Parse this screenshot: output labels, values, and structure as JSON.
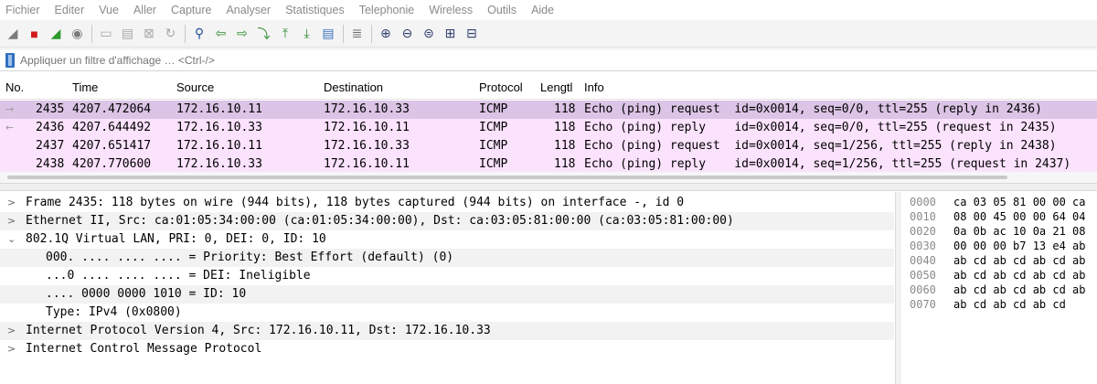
{
  "menu": [
    "Fichier",
    "Editer",
    "Vue",
    "Aller",
    "Capture",
    "Analyser",
    "Statistiques",
    "Telephonie",
    "Wireless",
    "Outils",
    "Aide"
  ],
  "toolbar": {
    "buttons": [
      {
        "name": "shark-fin-start-icon",
        "glyph": "◢",
        "color": "#7a7a7a"
      },
      {
        "name": "stop-capture-icon",
        "glyph": "■",
        "color": "#d11b1b"
      },
      {
        "name": "restart-capture-icon",
        "glyph": "◢",
        "color": "#2c9a2c"
      },
      {
        "name": "capture-options-icon",
        "glyph": "◉",
        "color": "#7a7a7a"
      },
      {
        "sep": true
      },
      {
        "name": "open-file-icon",
        "glyph": "▭",
        "color": "#a8a8a8"
      },
      {
        "name": "save-file-icon",
        "glyph": "▤",
        "color": "#a8a8a8"
      },
      {
        "name": "close-file-icon",
        "glyph": "⊠",
        "color": "#a8a8a8"
      },
      {
        "name": "reload-file-icon",
        "glyph": "↻",
        "color": "#a8a8a8"
      },
      {
        "sep": true
      },
      {
        "name": "find-packet-icon",
        "glyph": "⚲",
        "color": "#1f4f9a"
      },
      {
        "name": "go-back-icon",
        "glyph": "⇦",
        "color": "#2f8c2f"
      },
      {
        "name": "go-forward-icon",
        "glyph": "⇨",
        "color": "#2f8c2f"
      },
      {
        "name": "go-to-packet-icon",
        "glyph": "⤵",
        "color": "#2f8c2f"
      },
      {
        "name": "first-packet-icon",
        "glyph": "⤒",
        "color": "#2f8c2f"
      },
      {
        "name": "last-packet-icon",
        "glyph": "⤓",
        "color": "#2f8c2f"
      },
      {
        "name": "autoscroll-icon",
        "glyph": "▤",
        "color": "#3a6fc0"
      },
      {
        "sep": true
      },
      {
        "name": "colorize-icon",
        "glyph": "≣",
        "color": "#6b6b6b"
      },
      {
        "sep": true
      },
      {
        "name": "zoom-in-icon",
        "glyph": "⊕",
        "color": "#2f3f6f"
      },
      {
        "name": "zoom-out-icon",
        "glyph": "⊖",
        "color": "#2f3f6f"
      },
      {
        "name": "zoom-reset-icon",
        "glyph": "⊜",
        "color": "#2f3f6f"
      },
      {
        "name": "resize-columns-icon",
        "glyph": "⊞",
        "color": "#2f3f6f"
      },
      {
        "name": "expand-all-icon",
        "glyph": "⊟",
        "color": "#2f3f6f"
      }
    ]
  },
  "filter": {
    "placeholder": "Appliquer un filtre d'affichage … <Ctrl-/>"
  },
  "packet_list": {
    "columns": [
      "No.",
      "Time",
      "Source",
      "Destination",
      "Protocol",
      "Lengtl",
      "Info"
    ],
    "rows": [
      {
        "dir": "→",
        "no": "2435",
        "time": "4207.472064",
        "src": "172.16.10.11",
        "dst": "172.16.10.33",
        "proto": "ICMP",
        "len": "118",
        "info": "Echo (ping) request  id=0x0014, seq=0/0, ttl=255 (reply in 2436)",
        "bg": "#dcc4e6"
      },
      {
        "dir": "←",
        "no": "2436",
        "time": "4207.644492",
        "src": "172.16.10.33",
        "dst": "172.16.10.11",
        "proto": "ICMP",
        "len": "118",
        "info": "Echo (ping) reply    id=0x0014, seq=0/0, ttl=255 (request in 2435)",
        "bg": "#fbe2fd"
      },
      {
        "dir": "",
        "no": "2437",
        "time": "4207.651417",
        "src": "172.16.10.11",
        "dst": "172.16.10.33",
        "proto": "ICMP",
        "len": "118",
        "info": "Echo (ping) request  id=0x0014, seq=1/256, ttl=255 (reply in 2438)",
        "bg": "#fbe2fd"
      },
      {
        "dir": "",
        "no": "2438",
        "time": "4207.770600",
        "src": "172.16.10.33",
        "dst": "172.16.10.11",
        "proto": "ICMP",
        "len": "118",
        "info": "Echo (ping) reply    id=0x0014, seq=1/256, ttl=255 (request in 2437)",
        "bg": "#fbe2fd"
      }
    ]
  },
  "details": [
    {
      "chev": ">",
      "indent": 0,
      "text": "Frame 2435: 118 bytes on wire (944 bits), 118 bytes captured (944 bits) on interface -, id 0",
      "alt": false
    },
    {
      "chev": ">",
      "indent": 0,
      "text": "Ethernet II, Src: ca:01:05:34:00:00 (ca:01:05:34:00:00), Dst: ca:03:05:81:00:00 (ca:03:05:81:00:00)",
      "alt": true
    },
    {
      "chev": "⌄",
      "indent": 0,
      "text": "802.1Q Virtual LAN, PRI: 0, DEI: 0, ID: 10",
      "alt": false
    },
    {
      "chev": "",
      "indent": 1,
      "text": "000. .... .... .... = Priority: Best Effort (default) (0)",
      "alt": true
    },
    {
      "chev": "",
      "indent": 1,
      "text": "...0 .... .... .... = DEI: Ineligible",
      "alt": false
    },
    {
      "chev": "",
      "indent": 1,
      "text": ".... 0000 0000 1010 = ID: 10",
      "alt": true
    },
    {
      "chev": "",
      "indent": 1,
      "text": "Type: IPv4 (0x0800)",
      "alt": false
    },
    {
      "chev": ">",
      "indent": 0,
      "text": "Internet Protocol Version 4, Src: 172.16.10.11, Dst: 172.16.10.33",
      "alt": true
    },
    {
      "chev": ">",
      "indent": 0,
      "text": "Internet Control Message Protocol",
      "alt": false
    }
  ],
  "hex": [
    {
      "off": "0000",
      "bytes": "ca 03 05 81 00 00 ca"
    },
    {
      "off": "0010",
      "bytes": "08 00 45 00 00 64 04"
    },
    {
      "off": "0020",
      "bytes": "0a 0b ac 10 0a 21 08"
    },
    {
      "off": "0030",
      "bytes": "00 00 00 b7 13 e4 ab"
    },
    {
      "off": "0040",
      "bytes": "ab cd ab cd ab cd ab"
    },
    {
      "off": "0050",
      "bytes": "ab cd ab cd ab cd ab"
    },
    {
      "off": "0060",
      "bytes": "ab cd ab cd ab cd ab"
    },
    {
      "off": "0070",
      "bytes": "ab cd ab cd ab cd"
    }
  ]
}
